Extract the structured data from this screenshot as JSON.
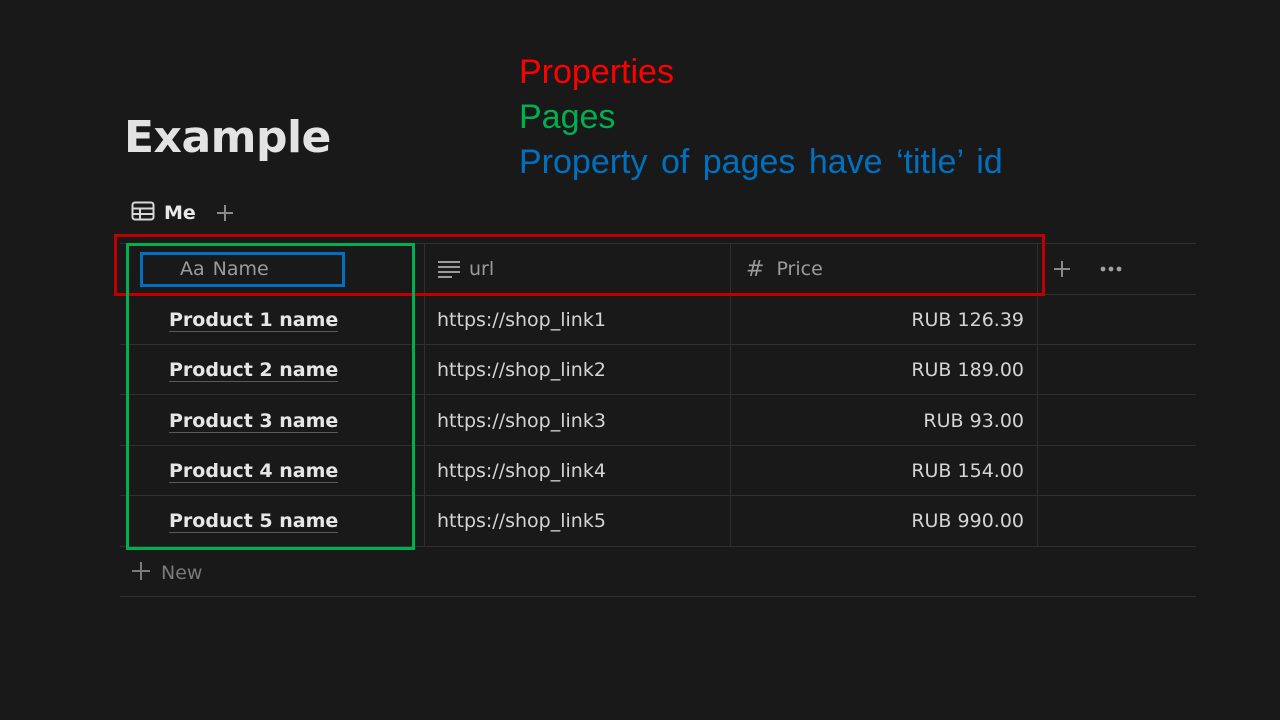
{
  "legend": {
    "properties": "Properties",
    "pages": "Pages",
    "title_note": "Property of pages have ‘title’ id"
  },
  "annotation_colors": {
    "properties": "#ff0000",
    "pages": "#00b050",
    "title_property": "#0070c0"
  },
  "page": {
    "title": "Example"
  },
  "view": {
    "tab_label": "Me",
    "tab_icon": "table-icon",
    "add_view_icon": "plus-icon"
  },
  "table": {
    "columns": [
      {
        "label": "Name",
        "icon_text": "Aa",
        "icon": "title-type-icon"
      },
      {
        "label": "url",
        "icon": "text-lines-icon"
      },
      {
        "label": "Price",
        "icon_text": "#",
        "icon": "number-hash-icon"
      }
    ],
    "rows": [
      {
        "name": "Product 1 name",
        "url": "https://shop_link1",
        "price": "RUB 126.39"
      },
      {
        "name": "Product 2 name",
        "url": "https://shop_link2",
        "price": "RUB 189.00"
      },
      {
        "name": "Product 3 name",
        "url": "https://shop_link3",
        "price": "RUB 93.00"
      },
      {
        "name": "Product 4 name",
        "url": "https://shop_link4",
        "price": "RUB 154.00"
      },
      {
        "name": "Product 5 name",
        "url": "https://shop_link5",
        "price": "RUB 990.00"
      }
    ],
    "new_row_label": "New",
    "add_column_icon": "plus-icon",
    "more_options_icon": "ellipsis-icon"
  }
}
